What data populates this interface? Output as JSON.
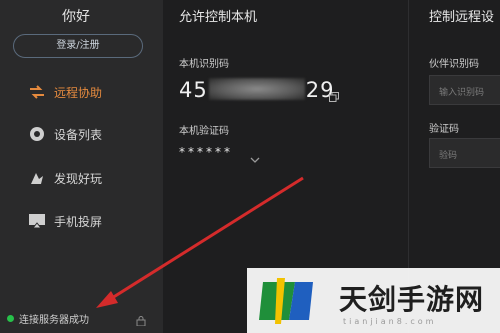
{
  "sidebar": {
    "greeting": "你好",
    "login_label": "登录/注册",
    "items": [
      {
        "label": "远程协助",
        "icon": "remote-assist-icon",
        "active": true
      },
      {
        "label": "设备列表",
        "icon": "device-list-icon",
        "active": false
      },
      {
        "label": "发现好玩",
        "icon": "discover-icon",
        "active": false
      },
      {
        "label": "手机投屏",
        "icon": "screen-cast-icon",
        "active": false
      }
    ],
    "status_text": "连接服务器成功",
    "status_color": "#27c14a"
  },
  "main": {
    "title": "允许控制本机",
    "id_label": "本机识别码",
    "id_prefix": "45",
    "id_suffix": "29",
    "code_label": "本机验证码",
    "code_value": "******"
  },
  "right": {
    "title": "控制远程设",
    "partner_label": "伙伴识别码",
    "partner_placeholder": "输入识别码",
    "code_label": "验证码",
    "code_placeholder": "验码"
  },
  "watermark": {
    "text": "天剑手游网",
    "url": "tianjian8.com"
  },
  "colors": {
    "accent": "#e58a3e",
    "arrow": "#d42b2b"
  }
}
